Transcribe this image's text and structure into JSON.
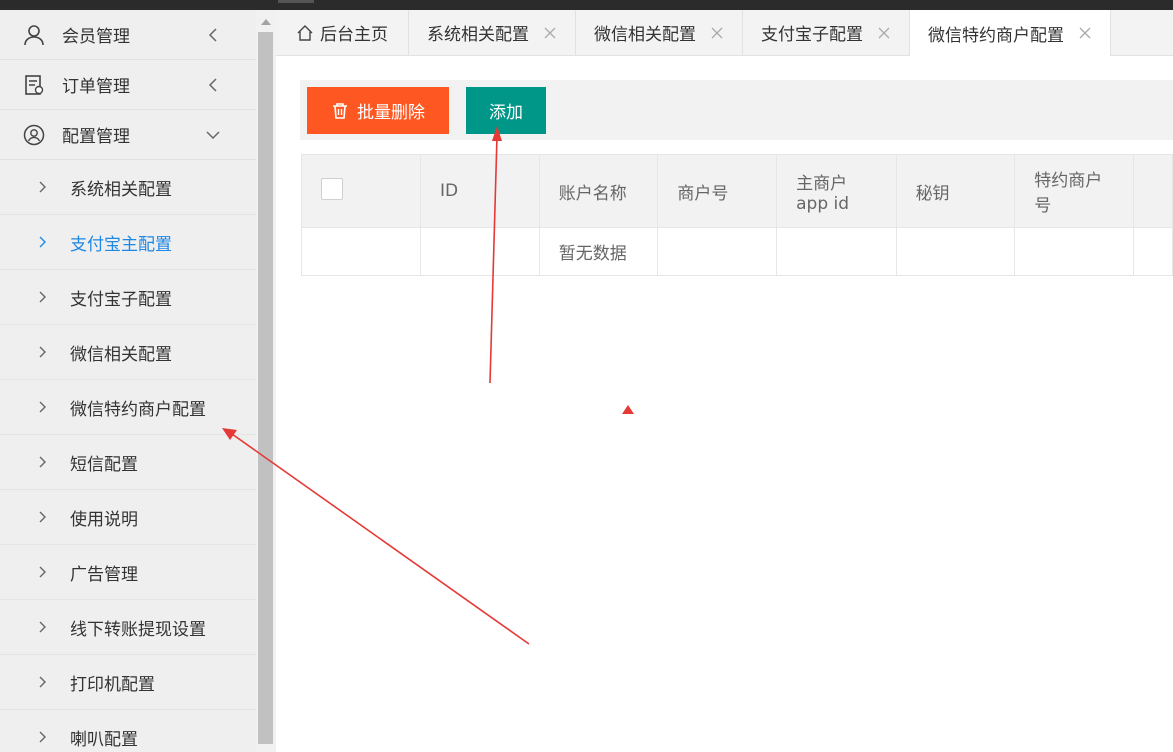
{
  "sidebar": {
    "top_items": [
      {
        "label": "会员管理",
        "icon": "user-icon"
      },
      {
        "label": "订单管理",
        "icon": "order-icon"
      },
      {
        "label": "配置管理",
        "icon": "user-circle-icon"
      }
    ],
    "sub_items": [
      {
        "label": "系统相关配置"
      },
      {
        "label": "支付宝主配置",
        "active": true
      },
      {
        "label": "支付宝子配置"
      },
      {
        "label": "微信相关配置"
      },
      {
        "label": "微信特约商户配置"
      },
      {
        "label": "短信配置"
      },
      {
        "label": "使用说明"
      },
      {
        "label": "广告管理"
      },
      {
        "label": "线下转账提现设置"
      },
      {
        "label": "打印机配置"
      },
      {
        "label": "喇叭配置"
      }
    ]
  },
  "tabs": [
    {
      "label": "后台主页",
      "icon": "home-icon"
    },
    {
      "label": "系统相关配置"
    },
    {
      "label": "微信相关配置"
    },
    {
      "label": "支付宝子配置"
    },
    {
      "label": "微信特约商户配置",
      "active": true
    }
  ],
  "toolbar": {
    "batch_delete_label": "批量删除",
    "add_label": "添加"
  },
  "table": {
    "headers": [
      "ID",
      "账户名称",
      "商户号",
      "主商户app id",
      "秘钥",
      "特约商户 号"
    ],
    "empty_text": "暂无数据"
  },
  "colors": {
    "accent_blue": "#1e88e5",
    "danger": "#ff5722",
    "primary": "#009688",
    "annotation_arrow": "#e53935"
  }
}
